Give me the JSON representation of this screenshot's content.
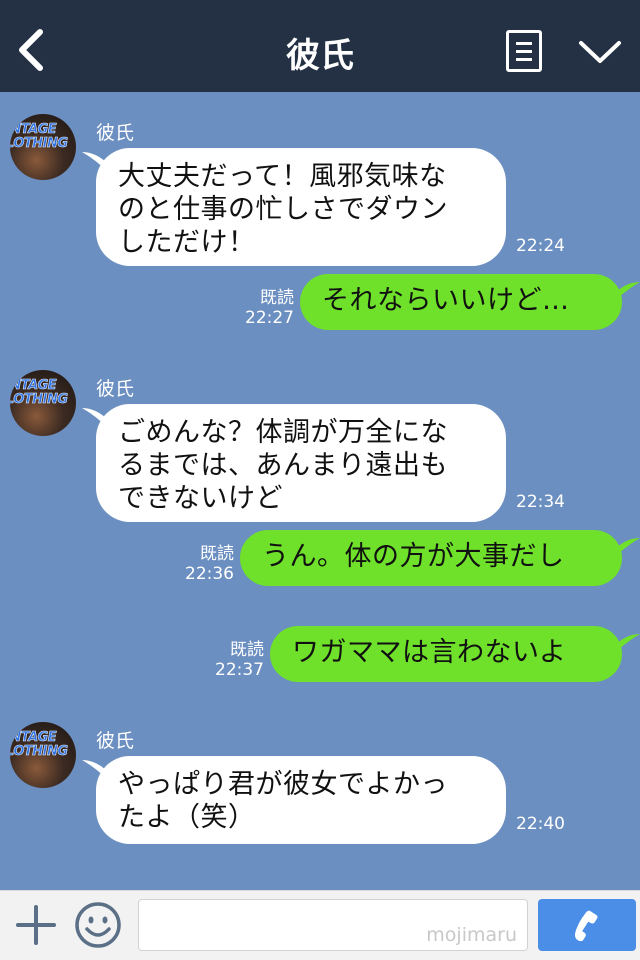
{
  "header": {
    "title": "彼氏"
  },
  "messages": [
    {
      "sender": "彼氏",
      "text_lines": [
        "大丈夫だって！風邪気味な",
        "のと仕事の忙しさでダウン",
        "しただけ！"
      ],
      "time": "22:24"
    },
    {
      "text": "それならいいけど…",
      "read": "既読",
      "time": "22:27"
    },
    {
      "sender": "彼氏",
      "text_lines": [
        "ごめんな？体調が万全にな",
        "るまでは、あんまり遠出も",
        "できないけど"
      ],
      "time": "22:34"
    },
    {
      "text": "うん。体の方が大事だし",
      "read": "既読",
      "time": "22:36"
    },
    {
      "text": "ワガママは言わないよ",
      "read": "既読",
      "time": "22:37"
    },
    {
      "sender": "彼氏",
      "text_lines": [
        "やっぱり君が彼女でよかっ",
        "たよ（笑）"
      ],
      "time": "22:40"
    }
  ],
  "avatar": {
    "line1": "INTAGE",
    "line2": "LOTHING"
  },
  "input": {
    "watermark": "mojimaru",
    "placeholder": ""
  },
  "icons": {
    "back": "chevron-left-icon",
    "menu": "notes-icon",
    "collapse": "chevron-down-icon",
    "plus": "plus-icon",
    "emoji": "smile-icon",
    "call": "phone-icon"
  },
  "colors": {
    "header": "#243144",
    "background": "#6b8fc0",
    "outgoing": "#6fe12a",
    "incoming": "#ffffff",
    "call_button": "#4b8ee8"
  }
}
